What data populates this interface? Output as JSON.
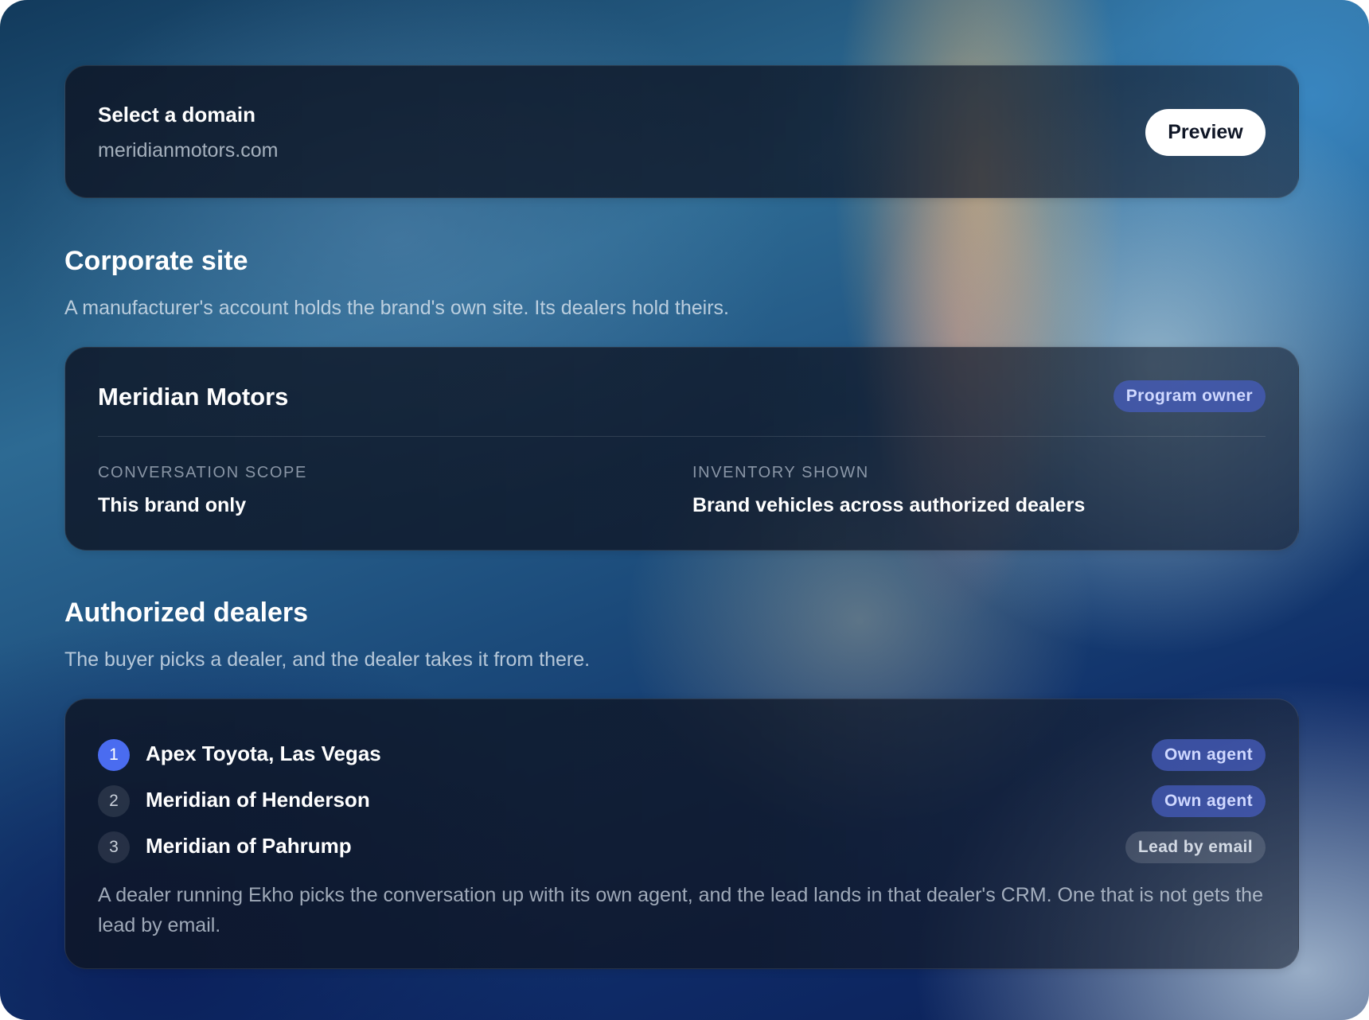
{
  "domain": {
    "label": "Select a domain",
    "value": "meridianmotors.com",
    "preview_label": "Preview"
  },
  "corporate": {
    "title": "Corporate site",
    "description": "A manufacturer's account holds the brand's own site. Its dealers hold theirs.",
    "brand_name": "Meridian Motors",
    "badge": "Program owner",
    "scope_label": "CONVERSATION SCOPE",
    "scope_value": "This brand only",
    "inventory_label": "INVENTORY SHOWN",
    "inventory_value": "Brand vehicles across authorized dealers"
  },
  "dealers": {
    "title": "Authorized dealers",
    "description": "The buyer picks a dealer, and the dealer takes it from there.",
    "items": [
      {
        "number": "1",
        "name": "Apex Toyota, Las Vegas",
        "badge": "Own agent",
        "selected": true
      },
      {
        "number": "2",
        "name": "Meridian of Henderson",
        "badge": "Own agent",
        "selected": false
      },
      {
        "number": "3",
        "name": "Meridian of Pahrump",
        "badge": "Lead by email",
        "selected": false
      }
    ],
    "note": "A dealer running Ekho picks the conversation up with its own agent, and the lead lands in that dealer's CRM. One that is not gets the lead by email."
  },
  "colors": {
    "accent": "#4a6cf0",
    "badge_blue_bg": "#465cbe",
    "badge_blue_text": "#cfd8ff",
    "card_bg": "#0e1626"
  }
}
